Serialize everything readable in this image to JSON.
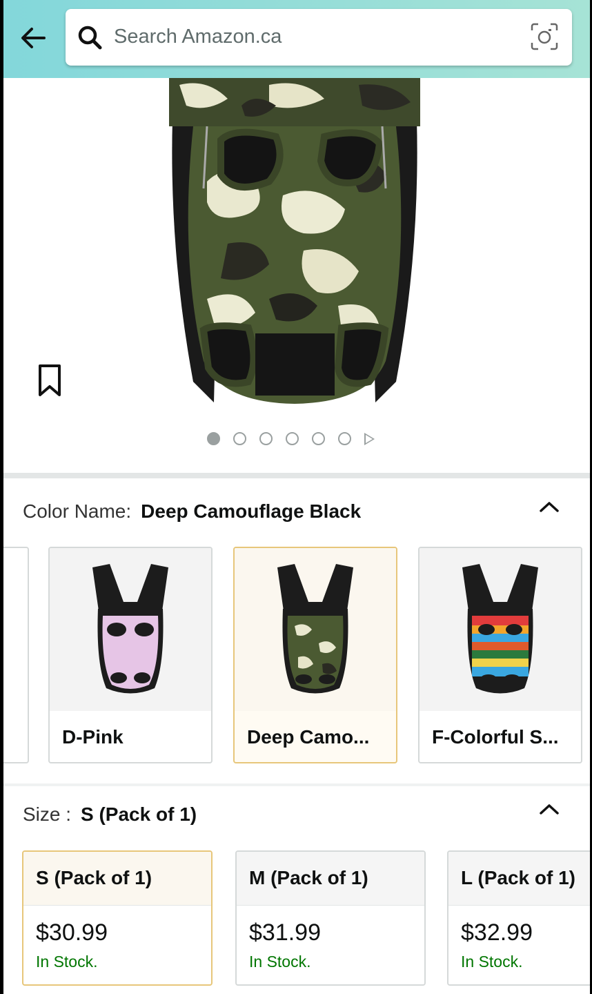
{
  "header": {
    "search_placeholder": "Search Amazon.ca"
  },
  "gallery": {
    "image_count": 6,
    "active_index": 0,
    "has_video": true
  },
  "color": {
    "label": "Color Name:",
    "selected": "Deep Camouflage Black",
    "swatches": [
      {
        "name": "D-Pink",
        "selected": false
      },
      {
        "name": "Deep Camo...",
        "selected": true
      },
      {
        "name": "F-Colorful S...",
        "selected": false
      }
    ]
  },
  "size": {
    "label": "Size :",
    "selected": "S (Pack of 1)",
    "options": [
      {
        "title": "S (Pack of 1)",
        "price": "$30.99",
        "stock": "In Stock.",
        "selected": true
      },
      {
        "title": "M (Pack of 1)",
        "price": "$31.99",
        "stock": "In Stock.",
        "selected": false
      },
      {
        "title": "L (Pack of 1)",
        "price": "$32.99",
        "stock": "In Stock.",
        "selected": false
      }
    ]
  },
  "colors": {
    "header_gradient_start": "#83d7da",
    "header_gradient_end": "#a6e3d6",
    "selected_border": "#e7c67a",
    "in_stock": "#007600"
  }
}
